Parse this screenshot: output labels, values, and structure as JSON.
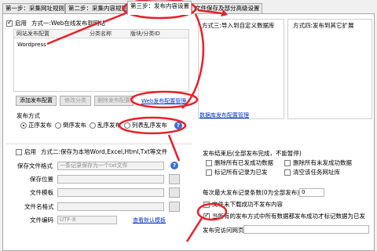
{
  "tabs": [
    "第一步：采集网址规则",
    "第二步：采集内容规则",
    "第三步：发布内容设置",
    "文件保存及部分高级设置"
  ],
  "method1": {
    "enable_label": "启用",
    "title": "方式一:Web在线发布到网站",
    "columns": [
      "网站发布配置",
      "分类名称",
      "版块/分类ID"
    ],
    "rows": [
      [
        "Wordpress",
        "",
        ""
      ]
    ],
    "buttons": [
      "添加发布配置",
      "修改分类",
      "删除发布配置"
    ],
    "manage_link": "Web发布配置管理",
    "publish_mode_label": "发布方式",
    "publish_modes": [
      "正序发布",
      "倒序发布",
      "乱序发布",
      "列表乱序发布"
    ]
  },
  "method3": {
    "title": "方式三:导入到自定义数据库",
    "link": "数据库发布配置管理"
  },
  "method4": {
    "title": "方式四:发布到其它扩展"
  },
  "method2": {
    "enable_label": "启用",
    "title": "方式二:保存为本地Word,Excel,Html,Txt等文件",
    "fields": [
      {
        "label": "保存文件格式",
        "value": "一条记录保存为一个txt文件"
      },
      {
        "label": "保存位置",
        "value": ""
      },
      {
        "label": "文件模板",
        "value": ""
      },
      {
        "label": "文件名格式",
        "value": ""
      },
      {
        "label": "文件编码",
        "value": "UTF-8"
      }
    ],
    "template_link": "查看默认模板"
  },
  "after_publish": {
    "title": "发布结束后(全部发布完成，不能暂停)",
    "options": [
      "删除所有已发成功数据",
      "删除所有未发成功数据",
      "标记所有记录为已发",
      "清空该任务网址库"
    ]
  },
  "max_per_publish": {
    "label": "每次最大发布记录条数(0为全部发布):",
    "value": "0"
  },
  "no_download_images": {
    "label": "文件未下载成功不发布内容"
  },
  "mark_success": {
    "label": "当所有的发布方式中所有数据都发布成功才标记数据为已发"
  },
  "access_url": {
    "label": "发布完访问网页",
    "value": ""
  },
  "icons": {
    "help": "question-help-icon"
  },
  "colors": {
    "annotation_red": "#e8202a",
    "link_blue": "#0033cc",
    "help_blue": "#3a6fd0"
  }
}
